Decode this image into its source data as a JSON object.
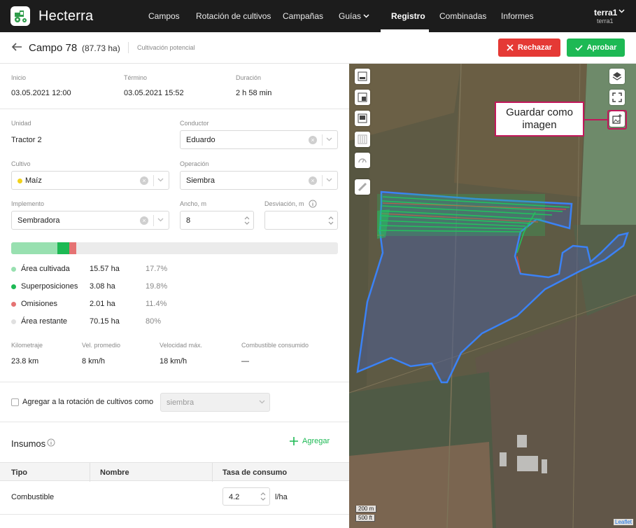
{
  "app": {
    "brand": "Hecterra",
    "nav": [
      "Campos",
      "Rotación de cultivos",
      "Campañas",
      "Guías",
      "Registro",
      "Combinadas",
      "Informes"
    ],
    "active_nav": "Registro",
    "user": {
      "name": "terra1",
      "sub": "terra1"
    }
  },
  "header": {
    "title": "Campo 78",
    "area": "(87.73 ha)",
    "subtitle": "Cultivación potencial",
    "reject_label": "Rechazar",
    "approve_label": "Aprobar"
  },
  "times": {
    "start_label": "Inicio",
    "start_value": "03.05.2021 12:00",
    "end_label": "Término",
    "end_value": "03.05.2021 15:52",
    "duration_label": "Duración",
    "duration_value": "2 h 58 min"
  },
  "form": {
    "unit_label": "Unidad",
    "unit_value": "Tractor 2",
    "driver_label": "Conductor",
    "driver_value": "Eduardo",
    "crop_label": "Cultivo",
    "crop_value": "Maíz",
    "crop_color": "#f2d21b",
    "operation_label": "Operación",
    "operation_value": "Siembra",
    "implement_label": "Implemento",
    "implement_value": "Sembradora",
    "width_label": "Ancho, m",
    "width_value": "8",
    "deviation_label": "Desviación, m",
    "deviation_value": ""
  },
  "coverage": {
    "items": [
      {
        "name": "Área cultivada",
        "ha": "15.57 ha",
        "pct": "17.7%",
        "color": "#98e0b0"
      },
      {
        "name": "Superposiciones",
        "ha": "3.08 ha",
        "pct": "19.8%",
        "color": "#1db954"
      },
      {
        "name": "Omisiones",
        "ha": "2.01 ha",
        "pct": "11.4%",
        "color": "#e57373"
      },
      {
        "name": "Área restante",
        "ha": "70.15 ha",
        "pct": "80%",
        "color": "#e0e0e0"
      }
    ]
  },
  "stats": {
    "km_label": "Kilometraje",
    "km_value": "23.8 km",
    "avg_label": "Vel. promedio",
    "avg_value": "8 km/h",
    "max_label": "Velocidad máx.",
    "max_value": "18 km/h",
    "fuel_label": "Combustible consumido",
    "fuel_value": "—"
  },
  "rotation": {
    "checkbox_label": "Agregar a la rotación de cultivos como",
    "select_value": "siembra"
  },
  "inputs": {
    "title": "Insumos",
    "add_label": "Agregar",
    "columns": [
      "Tipo",
      "Nombre",
      "Tasa de consumo"
    ],
    "row": {
      "type": "Combustible",
      "name": "",
      "rate": "4.2",
      "unit": "l/ha"
    }
  },
  "map": {
    "callout": "Guardar como imagen",
    "scale_m": "200 m",
    "scale_ft": "500 ft",
    "attribution": "Leaflet"
  }
}
